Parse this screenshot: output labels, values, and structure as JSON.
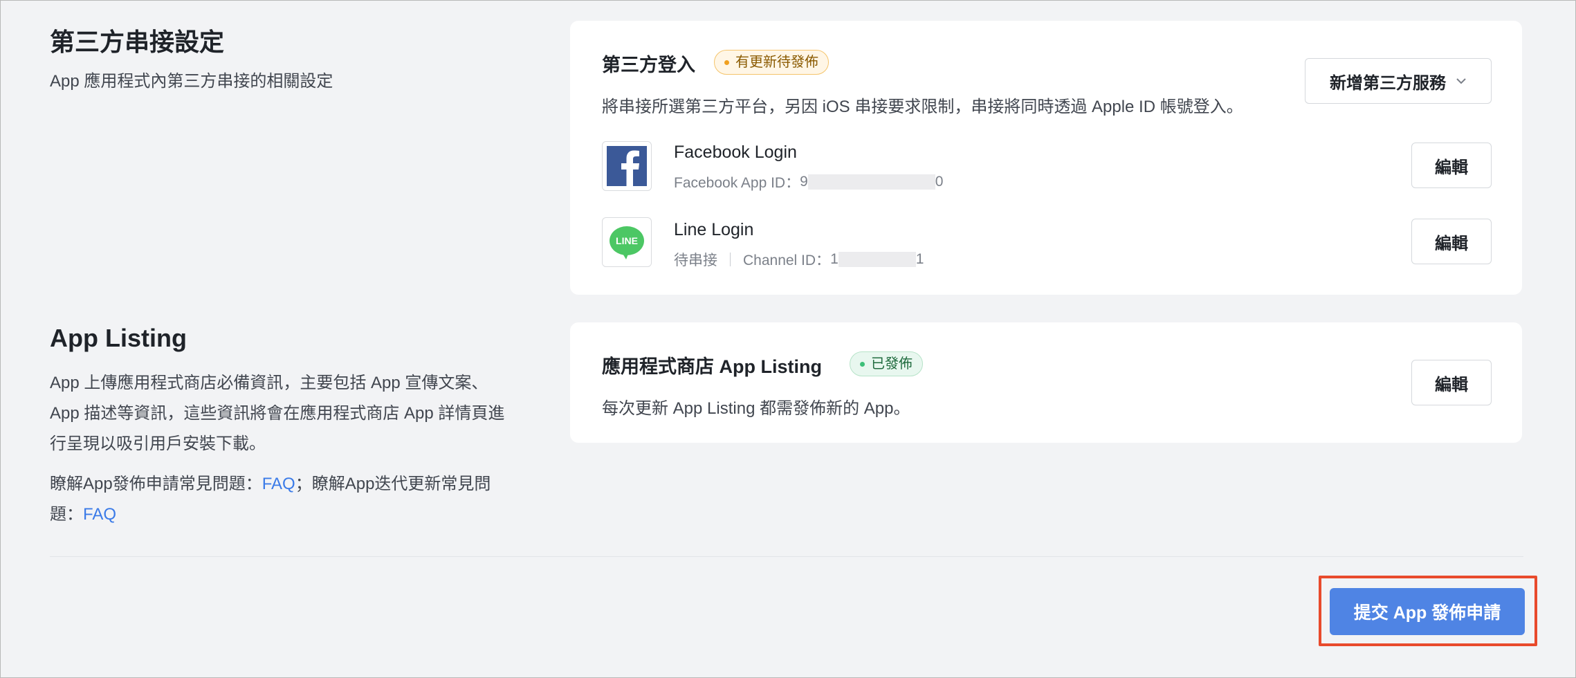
{
  "third_party_section": {
    "title": "第三方串接設定",
    "description": "App 應用程式內第三方串接的相關設定"
  },
  "third_party_card": {
    "title": "第三方登入",
    "badge": "有更新待發佈",
    "add_service_button": "新增第三方服務",
    "description": "將串接所選第三方平台，另因 iOS 串接要求限制，串接將同時透過 Apple ID 帳號登入。",
    "providers": [
      {
        "name": "Facebook Login",
        "meta_label": "Facebook App ID：",
        "id_start": "9",
        "id_end": "0",
        "edit_label": "編輯",
        "icon": "facebook-icon"
      },
      {
        "name": "Line Login",
        "status": "待串接",
        "meta_label": "Channel ID：",
        "id_start": "1",
        "id_end": "1",
        "edit_label": "編輯",
        "icon": "line-icon",
        "icon_text": "LINE"
      }
    ]
  },
  "listing_section": {
    "title": "App Listing",
    "description_lines": [
      "App 上傳應用程式商店必備資訊，主要包括 App 宣傳文案、",
      "App 描述等資訊，這些資訊將會在應用程式商店 App 詳情頁進",
      "行呈現以吸引用戶安裝下載。"
    ],
    "faq_line1_prefix": "瞭解App發佈申請常見問題：",
    "faq_link1": "FAQ",
    "faq_line1_mid": "；瞭解App迭代更新常見問",
    "faq_line2_prefix": "題：",
    "faq_link2": "FAQ"
  },
  "listing_card": {
    "title": "應用程式商店 App Listing",
    "badge": "已發佈",
    "description": "每次更新 App Listing 都需發佈新的 App。",
    "edit_label": "編輯"
  },
  "submit_button": "提交 App 發佈申請",
  "colors": {
    "background": "#f2f3f5",
    "primary": "#4f84e4",
    "link": "#3b7be8",
    "highlight_border": "#e84a2c",
    "facebook": "#3b5998",
    "line": "#4cc764"
  }
}
